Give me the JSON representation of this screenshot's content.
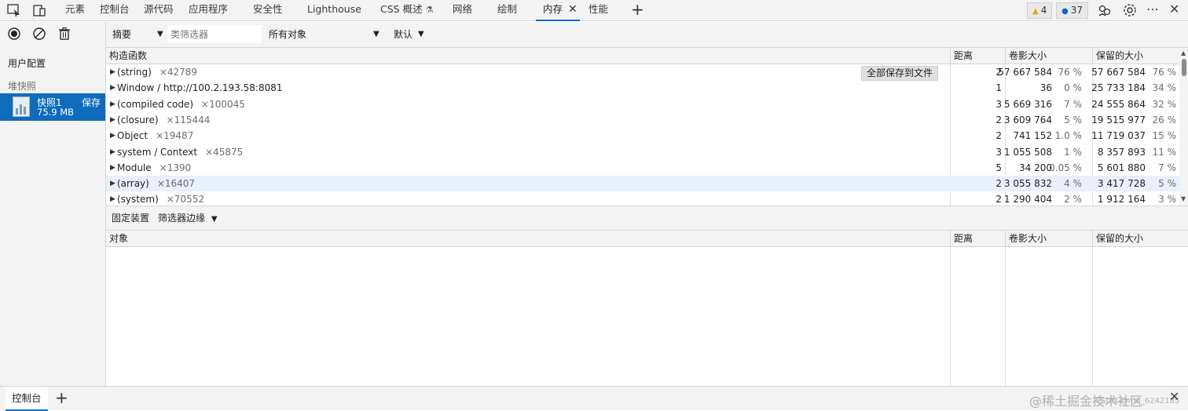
{
  "tabbar": {
    "tabs": [
      "元素",
      "控制台",
      "源代码",
      "应用程序",
      "安全性",
      "Lighthouse",
      "CSS 概述",
      "网络",
      "绘制",
      "内存",
      "性能"
    ],
    "css_flask_glyph": "⚗",
    "close_glyph": "✕",
    "add_glyph": "+",
    "warnings_count": "4",
    "messages_count": "37",
    "more_glyph": "⋯",
    "close_devtools_glyph": "✕"
  },
  "left_panel": {
    "profiles_heading": "用户配置",
    "heap_heading": "堆快照",
    "snapshot": {
      "name": "快照1",
      "save_label": "保存",
      "size": "75.9 MB"
    }
  },
  "toolbar": {
    "view": "摘要",
    "class_filter_placeholder": "类筛选器",
    "objects_scope": "所有对象",
    "default": "默认",
    "arrow": "▼"
  },
  "upper_grid": {
    "columns": [
      "构造函数",
      "距离",
      "卷影大小",
      "保留的大小"
    ],
    "save_all_label": "全部保存到文件",
    "rows": [
      {
        "name": "(string)",
        "count": "×42789",
        "distance": "2",
        "shallow": "57 667 584",
        "shallow_pct": "76 %",
        "retained": "57 667 584",
        "retained_pct": "76 %"
      },
      {
        "name": "Window / http://100.2.193.58:8081",
        "count": "",
        "distance": "1",
        "shallow": "36",
        "shallow_pct": "0 %",
        "retained": "25 733 184",
        "retained_pct": "34 %"
      },
      {
        "name": "(compiled code)",
        "count": "×100045",
        "distance": "3",
        "shallow": "5 669 316",
        "shallow_pct": "7 %",
        "retained": "24 555 864",
        "retained_pct": "32 %"
      },
      {
        "name": "(closure)",
        "count": "×115444",
        "distance": "2",
        "shallow": "3 609 764",
        "shallow_pct": "5 %",
        "retained": "19 515 977",
        "retained_pct": "26 %"
      },
      {
        "name": "Object",
        "count": "×19487",
        "distance": "2",
        "shallow": "741 152",
        "shallow_pct": "1.0 %",
        "retained": "11 719 037",
        "retained_pct": "15 %"
      },
      {
        "name": "system / Context",
        "count": "×45875",
        "distance": "3",
        "shallow": "1 055 508",
        "shallow_pct": "1 %",
        "retained": "8 357 893",
        "retained_pct": "11 %"
      },
      {
        "name": "Module",
        "count": "×1390",
        "distance": "5",
        "shallow": "34 200",
        "shallow_pct": "0.05 %",
        "retained": "5 601 880",
        "retained_pct": "7 %"
      },
      {
        "name": "(array)",
        "count": "×16407",
        "distance": "2",
        "shallow": "3 055 832",
        "shallow_pct": "4 %",
        "retained": "3 417 728",
        "retained_pct": "5 %"
      },
      {
        "name": "(system)",
        "count": "×70552",
        "distance": "2",
        "shallow": "1 290 404",
        "shallow_pct": "2 %",
        "retained": "1 912 164",
        "retained_pct": "3 %"
      }
    ]
  },
  "retainers": {
    "tab_label": "固定装置",
    "filter_edges_label": "筛选器边缘",
    "columns": [
      "对象",
      "距离",
      "卷影大小",
      "保留的大小"
    ]
  },
  "drawer": {
    "console_tab": "控制台",
    "add_glyph": "+",
    "watermark": "@稀土掘金技术社区",
    "csdn_mark": "CSDN @m0_6242185",
    "close_glyph": "✕"
  }
}
